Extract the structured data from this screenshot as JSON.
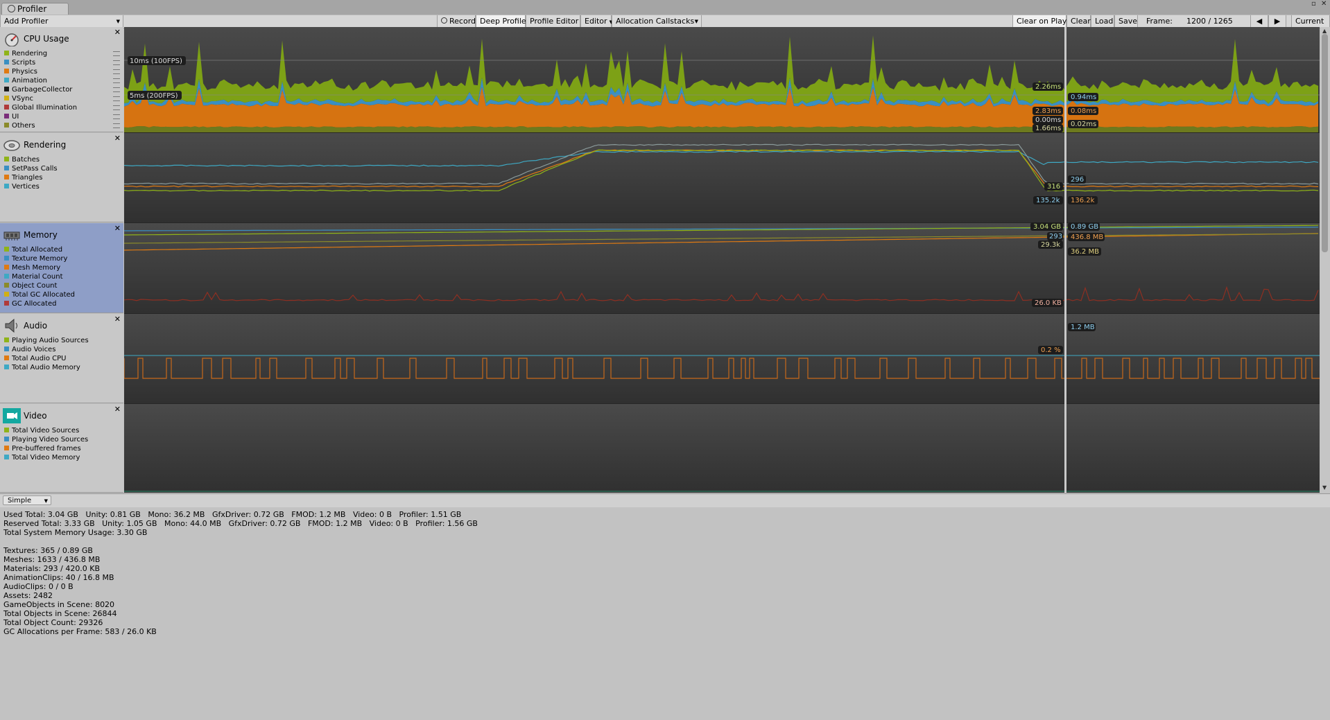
{
  "window": {
    "tab_title": "Profiler"
  },
  "toolbar": {
    "add_profiler": "Add Profiler",
    "record": "Record",
    "deep_profile": "Deep Profile",
    "profile_editor": "Profile Editor",
    "editor": "Editor",
    "allocation_callstacks": "Allocation Callstacks",
    "clear_on_play": "Clear on Play",
    "clear": "Clear",
    "load": "Load",
    "save": "Save",
    "frame_label": "Frame:",
    "frame_value": "1200 / 1265",
    "current": "Current",
    "states": {
      "record_on": false,
      "deep_profile_on": true,
      "clear_on_play_on": true
    }
  },
  "modules": [
    {
      "title": "CPU Usage",
      "icon": "cpu-gauge-icon",
      "legend": [
        {
          "label": "Rendering",
          "color": "#8fb318"
        },
        {
          "label": "Scripts",
          "color": "#3a8fc2"
        },
        {
          "label": "Physics",
          "color": "#e07a12"
        },
        {
          "label": "Animation",
          "color": "#3ea9c4"
        },
        {
          "label": "GarbageCollector",
          "color": "#1a1a1a"
        },
        {
          "label": "VSync",
          "color": "#d1b015"
        },
        {
          "label": "Global Illumination",
          "color": "#b03a3a"
        },
        {
          "label": "UI",
          "color": "#7a2e7a"
        },
        {
          "label": "Others",
          "color": "#8a8a2a"
        }
      ]
    },
    {
      "title": "Rendering",
      "icon": "rendering-disc-icon",
      "legend": [
        {
          "label": "Batches",
          "color": "#8fb318"
        },
        {
          "label": "SetPass Calls",
          "color": "#3a8fc2"
        },
        {
          "label": "Triangles",
          "color": "#e07a12"
        },
        {
          "label": "Vertices",
          "color": "#3ea9c4"
        }
      ]
    },
    {
      "title": "Memory",
      "icon": "memory-chip-icon",
      "legend": [
        {
          "label": "Total Allocated",
          "color": "#8fb318"
        },
        {
          "label": "Texture Memory",
          "color": "#3a8fc2"
        },
        {
          "label": "Mesh Memory",
          "color": "#e07a12"
        },
        {
          "label": "Material Count",
          "color": "#3ea9c4"
        },
        {
          "label": "Object Count",
          "color": "#8a8a2a"
        },
        {
          "label": "Total GC Allocated",
          "color": "#d1b015"
        },
        {
          "label": "GC Allocated",
          "color": "#b03a3a"
        }
      ]
    },
    {
      "title": "Audio",
      "icon": "speaker-icon",
      "legend": [
        {
          "label": "Playing Audio Sources",
          "color": "#8fb318"
        },
        {
          "label": "Audio Voices",
          "color": "#3a8fc2"
        },
        {
          "label": "Total Audio CPU",
          "color": "#e07a12"
        },
        {
          "label": "Total Audio Memory",
          "color": "#3ea9c4"
        }
      ]
    },
    {
      "title": "Video",
      "icon": "video-camera-icon",
      "legend": [
        {
          "label": "Total Video Sources",
          "color": "#8fb318"
        },
        {
          "label": "Playing Video Sources",
          "color": "#3a8fc2"
        },
        {
          "label": "Pre-buffered frames",
          "color": "#e07a12"
        },
        {
          "label": "Total Video Memory",
          "color": "#3ea9c4"
        }
      ]
    }
  ],
  "cpu": {
    "guide_10ms": "10ms (100FPS)",
    "guide_5ms": "5ms (200FPS)",
    "values_left": [
      "2.26ms",
      "2.83ms",
      "0.00ms",
      "1.66ms"
    ],
    "values_right": [
      "0.94ms",
      "0.08ms",
      "0.02ms"
    ]
  },
  "rendering": {
    "values_left": [
      "316",
      "135.2k"
    ],
    "values_right": [
      "296",
      "136.2k"
    ]
  },
  "memory": {
    "values_left": [
      "3.04 GB",
      "293",
      "29.3k",
      "26.0 KB"
    ],
    "values_right": [
      "0.89 GB",
      "436.8 MB",
      "36.2 MB"
    ]
  },
  "audio": {
    "values_left": [
      "0.2 %"
    ],
    "values_right": [
      "1.2 MB"
    ]
  },
  "view_mode": "Simple",
  "stats": [
    "Used Total: 3.04 GB   Unity: 0.81 GB   Mono: 36.2 MB   GfxDriver: 0.72 GB   FMOD: 1.2 MB   Video: 0 B   Profiler: 1.51 GB",
    "Reserved Total: 3.33 GB   Unity: 1.05 GB   Mono: 44.0 MB   GfxDriver: 0.72 GB   FMOD: 1.2 MB   Video: 0 B   Profiler: 1.56 GB",
    "Total System Memory Usage: 3.30 GB",
    "",
    "Textures: 365 / 0.89 GB",
    "Meshes: 1633 / 436.8 MB",
    "Materials: 293 / 420.0 KB",
    "AnimationClips: 40 / 16.8 MB",
    "AudioClips: 0 / 0 B",
    "Assets: 2482",
    "GameObjects in Scene: 8020",
    "Total Objects in Scene: 26844",
    "Total Object Count: 29326",
    "GC Allocations per Frame: 583 / 26.0 KB"
  ]
}
